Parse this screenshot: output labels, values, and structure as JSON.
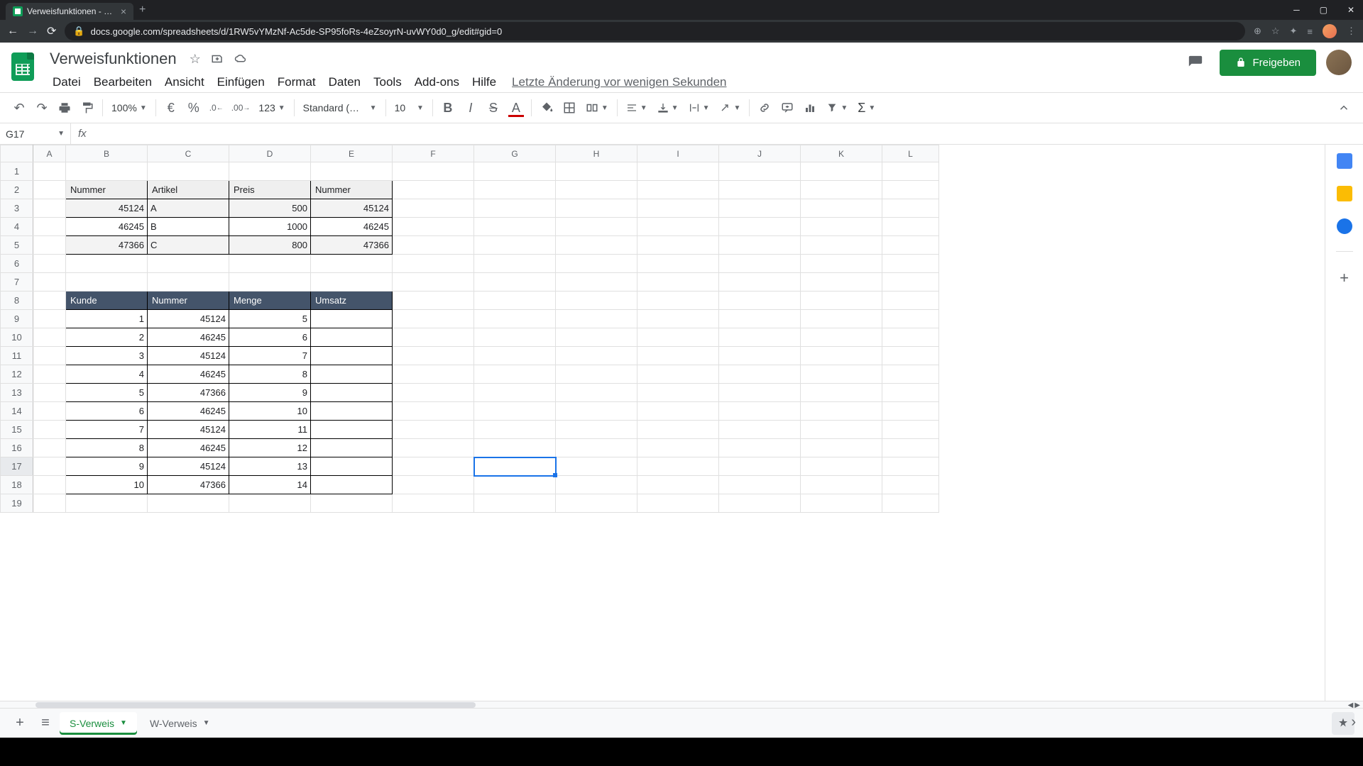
{
  "browser": {
    "tab_title": "Verweisfunktionen - Google Tab…",
    "url": "docs.google.com/spreadsheets/d/1RW5vYMzNf-Ac5de-SP95foRs-4eZsoyrN-uvWY0d0_g/edit#gid=0"
  },
  "header": {
    "doc_title": "Verweisfunktionen",
    "last_edit": "Letzte Änderung vor wenigen Sekunden",
    "share_label": "Freigeben"
  },
  "menu": {
    "items": [
      "Datei",
      "Bearbeiten",
      "Ansicht",
      "Einfügen",
      "Format",
      "Daten",
      "Tools",
      "Add-ons",
      "Hilfe"
    ]
  },
  "toolbar": {
    "zoom": "100%",
    "currency": "€",
    "percent": "%",
    "dec_dec": ".0",
    "dec_inc": ".00",
    "num_format": "123",
    "font": "Standard (…",
    "font_size": "10"
  },
  "formula": {
    "cell_ref": "G17",
    "fx": "fx",
    "value": ""
  },
  "columns": [
    "A",
    "B",
    "C",
    "D",
    "E",
    "F",
    "G",
    "H",
    "I",
    "J",
    "K",
    "L"
  ],
  "table1": {
    "headers": [
      "Nummer",
      "Artikel",
      "Preis",
      "Nummer"
    ],
    "rows": [
      [
        "45124",
        "A",
        "500",
        "45124"
      ],
      [
        "46245",
        "B",
        "1000",
        "46245"
      ],
      [
        "47366",
        "C",
        "800",
        "47366"
      ]
    ]
  },
  "table2": {
    "headers": [
      "Kunde",
      "Nummer",
      "Menge",
      "Umsatz"
    ],
    "rows": [
      [
        "1",
        "45124",
        "5",
        ""
      ],
      [
        "2",
        "46245",
        "6",
        ""
      ],
      [
        "3",
        "45124",
        "7",
        ""
      ],
      [
        "4",
        "46245",
        "8",
        ""
      ],
      [
        "5",
        "47366",
        "9",
        ""
      ],
      [
        "6",
        "46245",
        "10",
        ""
      ],
      [
        "7",
        "45124",
        "11",
        ""
      ],
      [
        "8",
        "46245",
        "12",
        ""
      ],
      [
        "9",
        "45124",
        "13",
        ""
      ],
      [
        "10",
        "47366",
        "14",
        ""
      ]
    ]
  },
  "sheets": {
    "active": "S-Verweis",
    "other": "W-Verweis"
  },
  "selected": {
    "col": "G",
    "row": 17
  }
}
